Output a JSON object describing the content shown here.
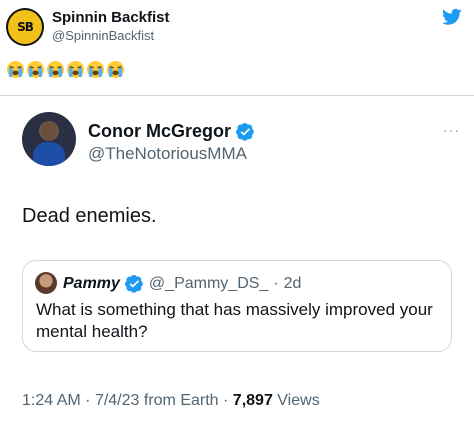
{
  "outer_tweet": {
    "author_name": "Spinnin Backfist",
    "author_handle": "@SpinninBackfist",
    "avatar_logo": "SB",
    "emoji_count": 6,
    "emoji_name": "loudly-crying-face"
  },
  "embedded_tweet": {
    "author_name": "Conor McGregor",
    "author_handle": "@TheNotoriousMMA",
    "more_label": "···",
    "text": "Dead enemies.",
    "quote": {
      "author_name": "Pammy",
      "author_handle": "@_Pammy_DS_",
      "separator": "·",
      "age": "2d",
      "text": "What is something that has massively improved your mental health?"
    },
    "time": "1:24 AM",
    "dot1": "·",
    "date": "7/4/23",
    "source": "from Earth",
    "dot2": "·",
    "views_count": "7,897",
    "views_label": "Views"
  },
  "colors": {
    "brand_blue": "#1d9bf0",
    "secondary_text": "#536471",
    "border": "#cfd9de"
  }
}
